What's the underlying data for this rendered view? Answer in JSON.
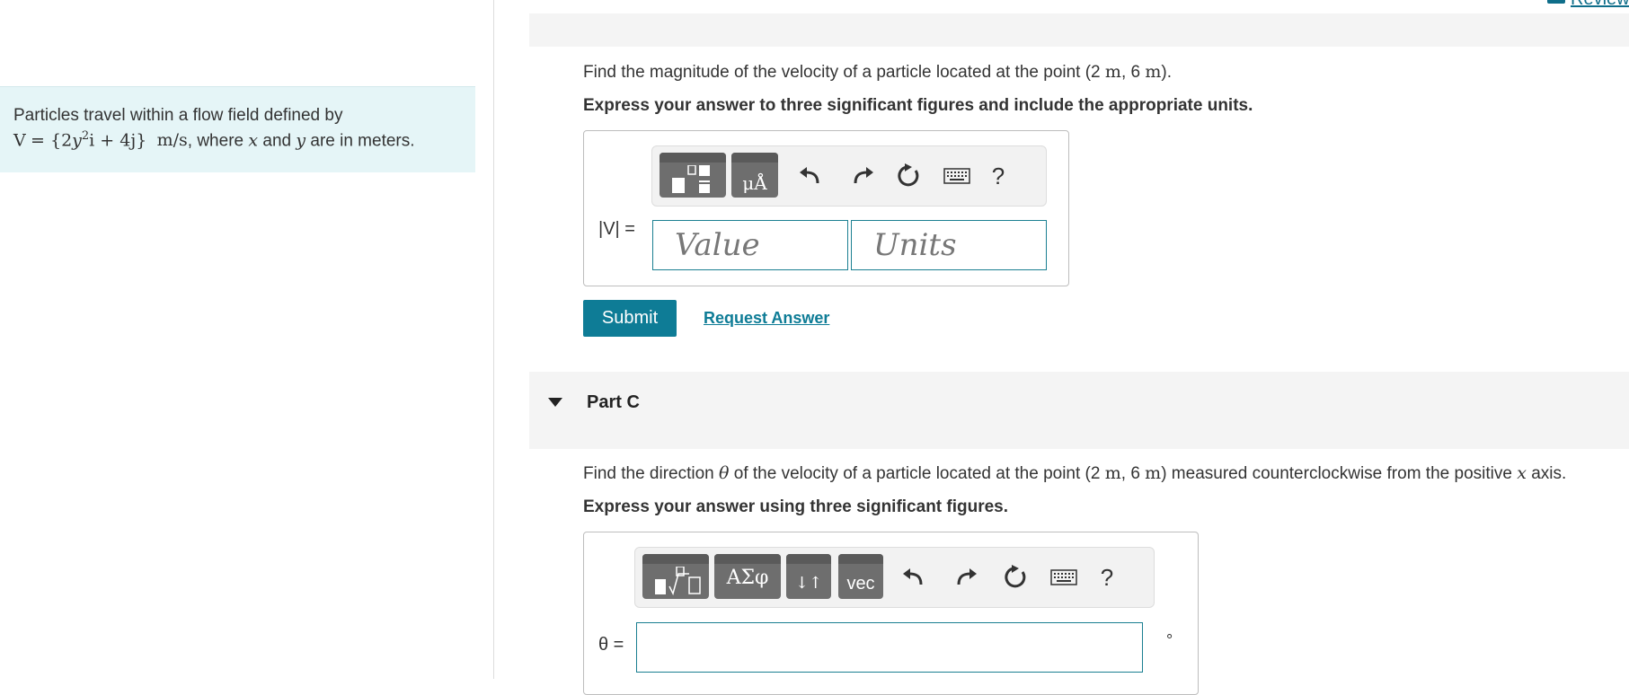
{
  "left": {
    "problem_line1": "Particles travel within a flow field defined by",
    "problem_v": "V",
    "problem_eq": "= {2",
    "problem_y": "y",
    "problem_sup": "2",
    "problem_rest": "i + 4j}",
    "problem_units": "m/s",
    "problem_tail1": ", where",
    "problem_x": "x",
    "problem_and": "and",
    "problem_y2": "y",
    "problem_tail2": "are in meters."
  },
  "header": {
    "review_label": "Review"
  },
  "part_b": {
    "question_prefix": "Find the magnitude of the velocity of a particle located at the point (2",
    "unit_m1": "m",
    "comma": ", 6",
    "unit_m2": "m",
    "question_suffix": ").",
    "instruction": "Express your answer to three significant figures and include the appropriate units.",
    "templates_icon": "templates-icon",
    "units_icon": "units-icon",
    "units_glyph": "μÅ",
    "help_glyph": "?",
    "field_label": "|V| =",
    "value_placeholder": "Value",
    "units_placeholder": "Units",
    "submit_label": "Submit",
    "request_label": "Request Answer"
  },
  "part_c": {
    "title": "Part C",
    "question_prefix": "Find the direction",
    "theta": "θ",
    "question_mid": "of the velocity of a particle located at the point (2",
    "unit_m1": "m",
    "comma": ", 6",
    "unit_m2": "m",
    "question_mid2": ") measured counterclockwise from the positive",
    "x_var": "x",
    "question_suffix": "axis.",
    "instruction": "Express your answer using three significant figures.",
    "greek_glyph": "ΑΣφ",
    "arrows_glyph": "↓↑",
    "vec_glyph": "vec",
    "help_glyph": "?",
    "field_label": "θ =",
    "degree_symbol": "°"
  },
  "colors": {
    "accent": "#0e7c96",
    "problem_bg": "#e5f5f7",
    "band_bg": "#f4f4f4"
  }
}
